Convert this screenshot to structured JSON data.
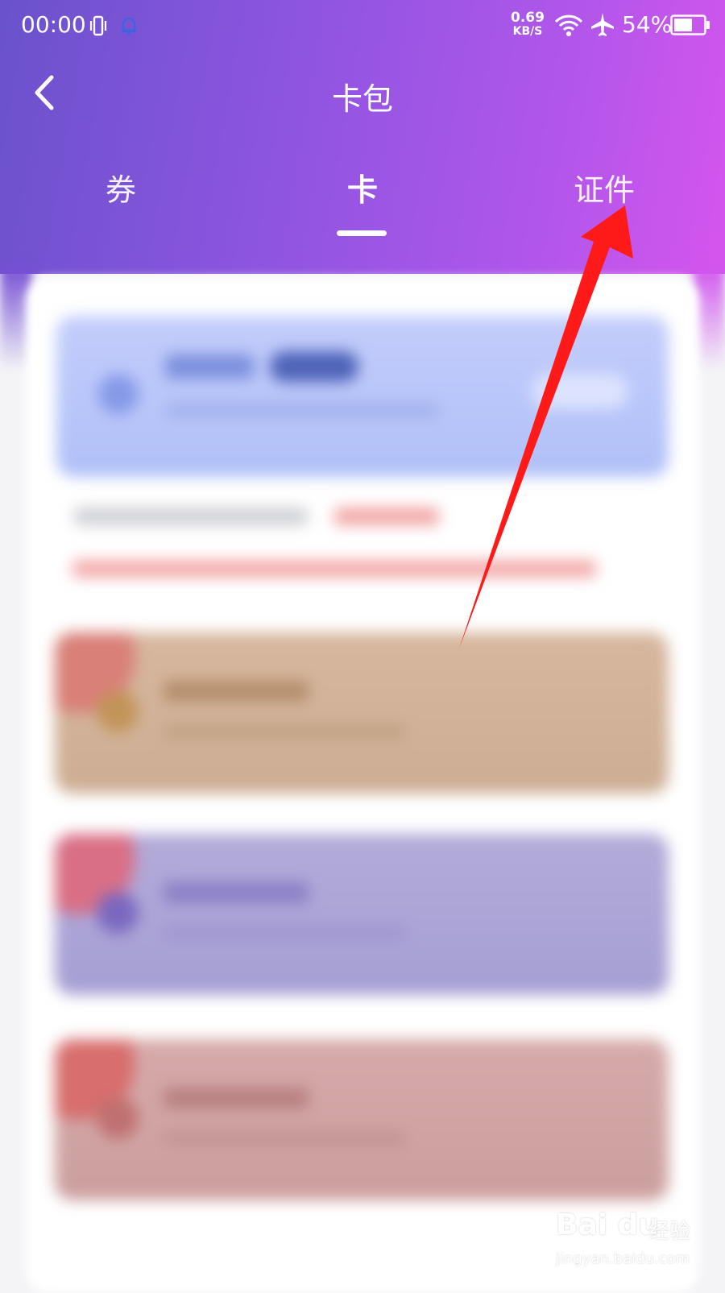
{
  "status_bar": {
    "time": "00:00",
    "net_speed_value": "0.69",
    "net_speed_unit": "KB/S",
    "battery": "54%"
  },
  "header": {
    "title": "卡包"
  },
  "tabs": [
    {
      "label": "券",
      "active": false
    },
    {
      "label": "卡",
      "active": true
    },
    {
      "label": "证件",
      "active": false
    }
  ],
  "watermark": {
    "logo": "Bai du",
    "brand": "经验",
    "url": "jingyan.baidu.com"
  },
  "colors": {
    "header_gradient_start": "#6a52cc",
    "header_gradient_end": "#d555ee",
    "arrow": "#ff1a1a"
  },
  "icons": [
    "vibrate-icon",
    "bell-icon",
    "wifi-icon",
    "airplane-icon",
    "battery-icon",
    "back-arrow-icon"
  ]
}
